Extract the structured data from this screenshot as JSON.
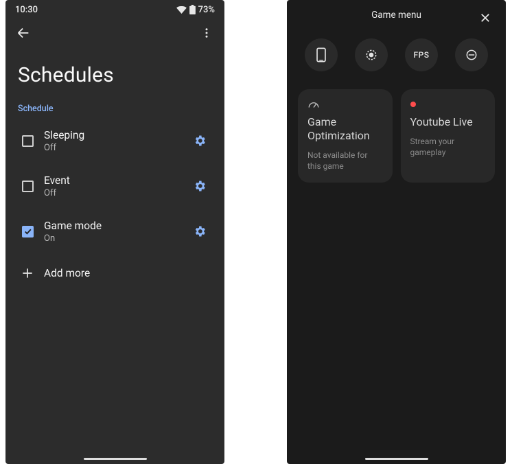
{
  "left": {
    "status": {
      "time": "10:30",
      "battery": "73%"
    },
    "title": "Schedules",
    "subheader": "Schedule",
    "items": [
      {
        "label": "Sleeping",
        "state": "Off",
        "checked": false
      },
      {
        "label": "Event",
        "state": "Off",
        "checked": false
      },
      {
        "label": "Game mode",
        "state": "On",
        "checked": true
      }
    ],
    "add_label": "Add more"
  },
  "right": {
    "title": "Game menu",
    "buttons": [
      {
        "name": "screenshot-icon"
      },
      {
        "name": "record-icon"
      },
      {
        "name": "fps-icon",
        "text": "FPS"
      },
      {
        "name": "dnd-icon"
      }
    ],
    "cards": [
      {
        "title": "Game Optimization",
        "subtitle": "Not available for this game",
        "icon": "gauge"
      },
      {
        "title": "Youtube Live",
        "subtitle": "Stream your gameplay",
        "icon": "reddot"
      }
    ]
  }
}
